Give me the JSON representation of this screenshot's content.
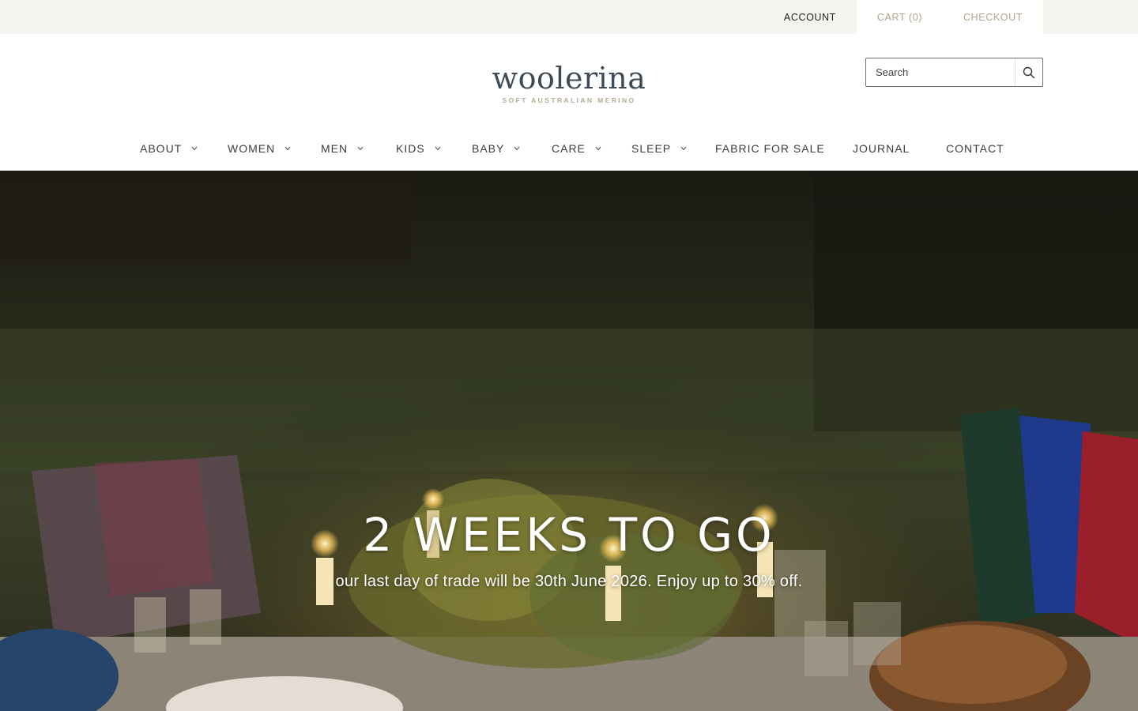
{
  "topbar": {
    "account": "ACCOUNT",
    "cart": "CART (0)",
    "checkout": "CHECKOUT"
  },
  "logo": {
    "wordmark": "woolerina",
    "tagline": "SOFT AUSTRALIAN MERINO"
  },
  "search": {
    "placeholder": "Search",
    "icon": "search-icon"
  },
  "nav": {
    "items": [
      {
        "label": "ABOUT",
        "has_dropdown": true
      },
      {
        "label": "WOMEN",
        "has_dropdown": true
      },
      {
        "label": "MEN",
        "has_dropdown": true
      },
      {
        "label": "KIDS",
        "has_dropdown": true
      },
      {
        "label": "BABY",
        "has_dropdown": true
      },
      {
        "label": "CARE",
        "has_dropdown": true
      },
      {
        "label": "SLEEP",
        "has_dropdown": true
      },
      {
        "label": "FABRIC FOR SALE",
        "has_dropdown": false
      },
      {
        "label": "JOURNAL",
        "has_dropdown": false
      },
      {
        "label": "CONTACT",
        "has_dropdown": false
      }
    ]
  },
  "hero": {
    "title": "2 WEEKS TO GO",
    "subtitle": "our last day of trade will be 30th June 2026. Enjoy up to 30% off."
  },
  "colors": {
    "topbar_bg": "#f5f4ef",
    "accent": "#b0a48c",
    "logo_text": "#3f4a54"
  }
}
